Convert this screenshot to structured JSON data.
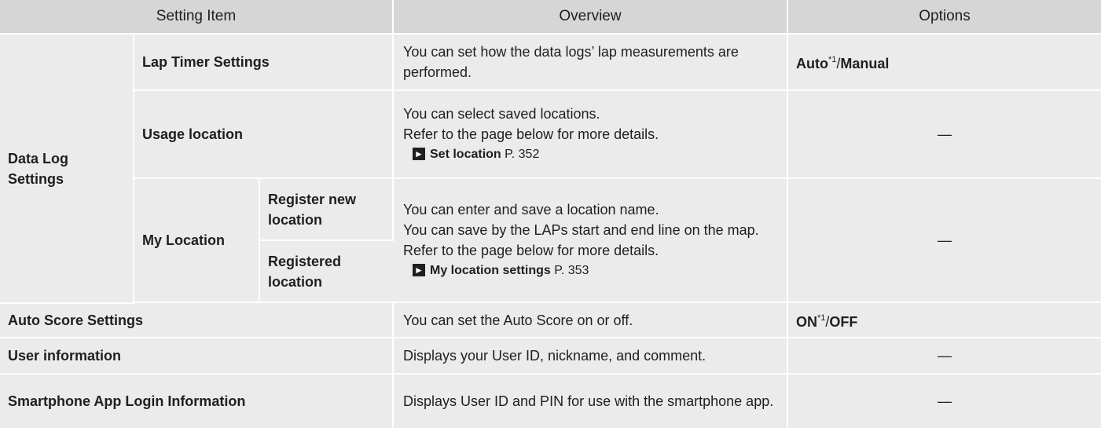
{
  "header": {
    "setting_item": "Setting Item",
    "overview": "Overview",
    "options": "Options"
  },
  "rows": {
    "data_log": {
      "label": "Data Log Settings",
      "lap_timer": {
        "label": "Lap Timer Settings",
        "overview": "You can set how the data logs’ lap measurements are performed.",
        "option_a": "Auto",
        "option_a_note": "*1",
        "option_sep": "/",
        "option_b": "Manual"
      },
      "usage_location": {
        "label": "Usage location",
        "overview_1": "You can select saved locations.",
        "overview_2": "Refer to the page below for more details.",
        "ref_title": "Set location",
        "ref_page": "P. 352",
        "options": "—"
      },
      "my_location": {
        "label": "My Location",
        "sub_1": "Register new location",
        "sub_2": "Registered location",
        "overview_1": "You can enter and save a location name.",
        "overview_2": "You can save by the LAPs start and end line on the map.",
        "overview_3": "Refer to the page below for more details.",
        "ref_title": "My location settings",
        "ref_page": "P. 353",
        "options": "—"
      }
    },
    "auto_score": {
      "label": "Auto Score Settings",
      "overview": "You can set the Auto Score on or off.",
      "option_a": "ON",
      "option_a_note": "*1",
      "option_sep": "/",
      "option_b": "OFF"
    },
    "user_info": {
      "label": "User information",
      "overview": "Displays your User ID, nickname, and comment.",
      "options": "—"
    },
    "smartphone": {
      "label": "Smartphone App Login Information",
      "overview": "Displays User ID and PIN for use with the smartphone app.",
      "options": "—"
    }
  },
  "icons": {
    "reference_arrow": "right-arrow-box-icon"
  }
}
